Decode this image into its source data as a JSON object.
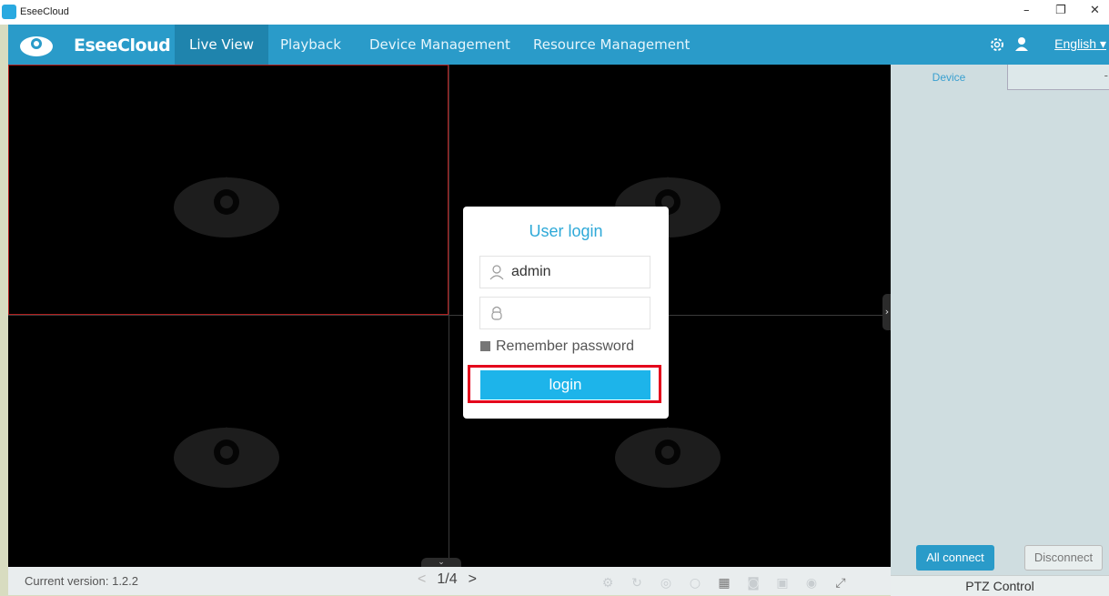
{
  "window": {
    "title": "EseeCloud",
    "minimize": "–",
    "restore": "❐",
    "close": "✕"
  },
  "nav": {
    "brand": "EseeCloud",
    "tabs": [
      {
        "label": "Live View",
        "active": true
      },
      {
        "label": "Playback"
      },
      {
        "label": "Device Management"
      },
      {
        "label": "Resource Management"
      }
    ],
    "language": "English ▾",
    "settings_icon": "gear-icon",
    "user_icon": "user-icon",
    "accent_color": "#2a9bc9"
  },
  "sidebar": {
    "tab_device": "Device",
    "tab_other": "-",
    "all_connect": "All connect",
    "disconnect": "Disconnect",
    "ptz": "PTZ Control"
  },
  "status": {
    "version": "Current version: 1.2.2",
    "page": "1/4",
    "prev": "<",
    "next": ">"
  },
  "login": {
    "title": "User login",
    "username": "admin",
    "password": "",
    "remember": "Remember password",
    "button": "login",
    "highlight_color": "#e4001b"
  }
}
